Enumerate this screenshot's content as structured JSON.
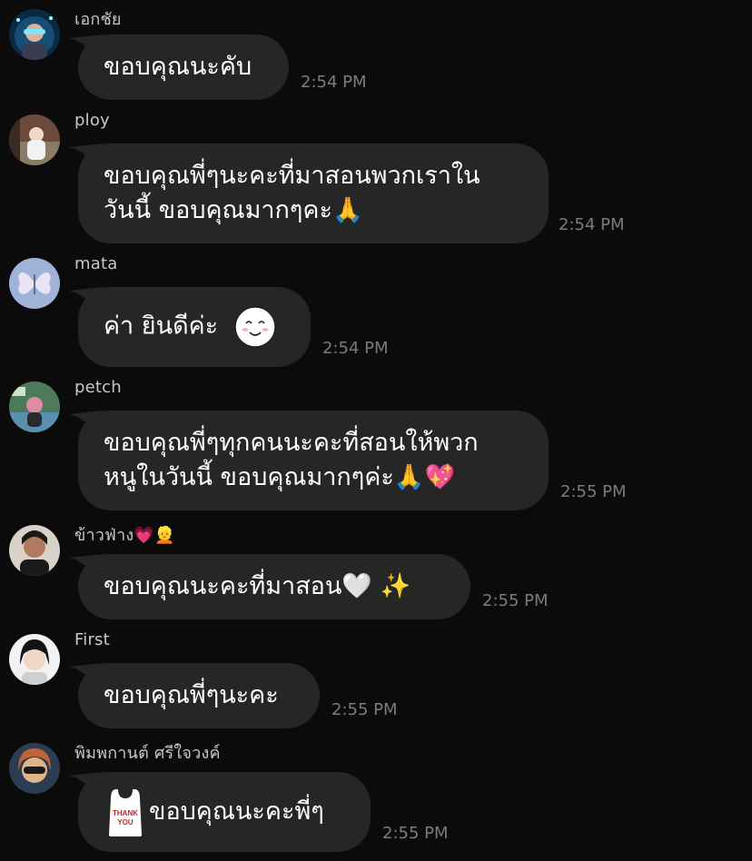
{
  "messages": [
    {
      "sender": "เอกชัย",
      "lines": [
        "ขอบคุณนะคับ"
      ],
      "time": "2:54 PM"
    },
    {
      "sender": "ploy",
      "lines": [
        "ขอบคุณพี่ๆนะคะที่มาสอนพวกเราใน",
        "วันนี้ ขอบคุณมากๆคะ"
      ],
      "emoji": [
        "🙏"
      ],
      "time": "2:54 PM"
    },
    {
      "sender": "mata",
      "lines": [
        "ค่า ยินดีค่ะ"
      ],
      "sticker": "smiley-face-sticker",
      "time": "2:54 PM"
    },
    {
      "sender": "petch",
      "lines": [
        "ขอบคุณพี่ๆทุกคนนะคะที่สอนให้พวก",
        "หนูในวันนี้ ขอบคุณมากๆค่ะ"
      ],
      "emoji": [
        "🙏",
        "💖"
      ],
      "time": "2:55 PM"
    },
    {
      "sender": "ข้าวฟ่าง",
      "sender_emoji": [
        "💗",
        "👱"
      ],
      "lines": [
        "ขอบคุณนะคะที่มาสอน"
      ],
      "emoji": [
        "🤍",
        "✨"
      ],
      "time": "2:55 PM"
    },
    {
      "sender": "First",
      "lines": [
        "ขอบคุณพี่ๆนะคะ"
      ],
      "time": "2:55 PM"
    },
    {
      "sender": "พิมพกานต์ ศรีใจวงค์",
      "sticker_text": [
        "THANK",
        "YOU"
      ],
      "lines": [
        "ขอบคุณนะคะพี่ๆ"
      ],
      "time": "2:55 PM"
    }
  ],
  "colors": {
    "background": "#0b0b0b",
    "bubble": "#262626",
    "timestamp": "#7c7c7c",
    "sender": "#c8c8c8"
  }
}
